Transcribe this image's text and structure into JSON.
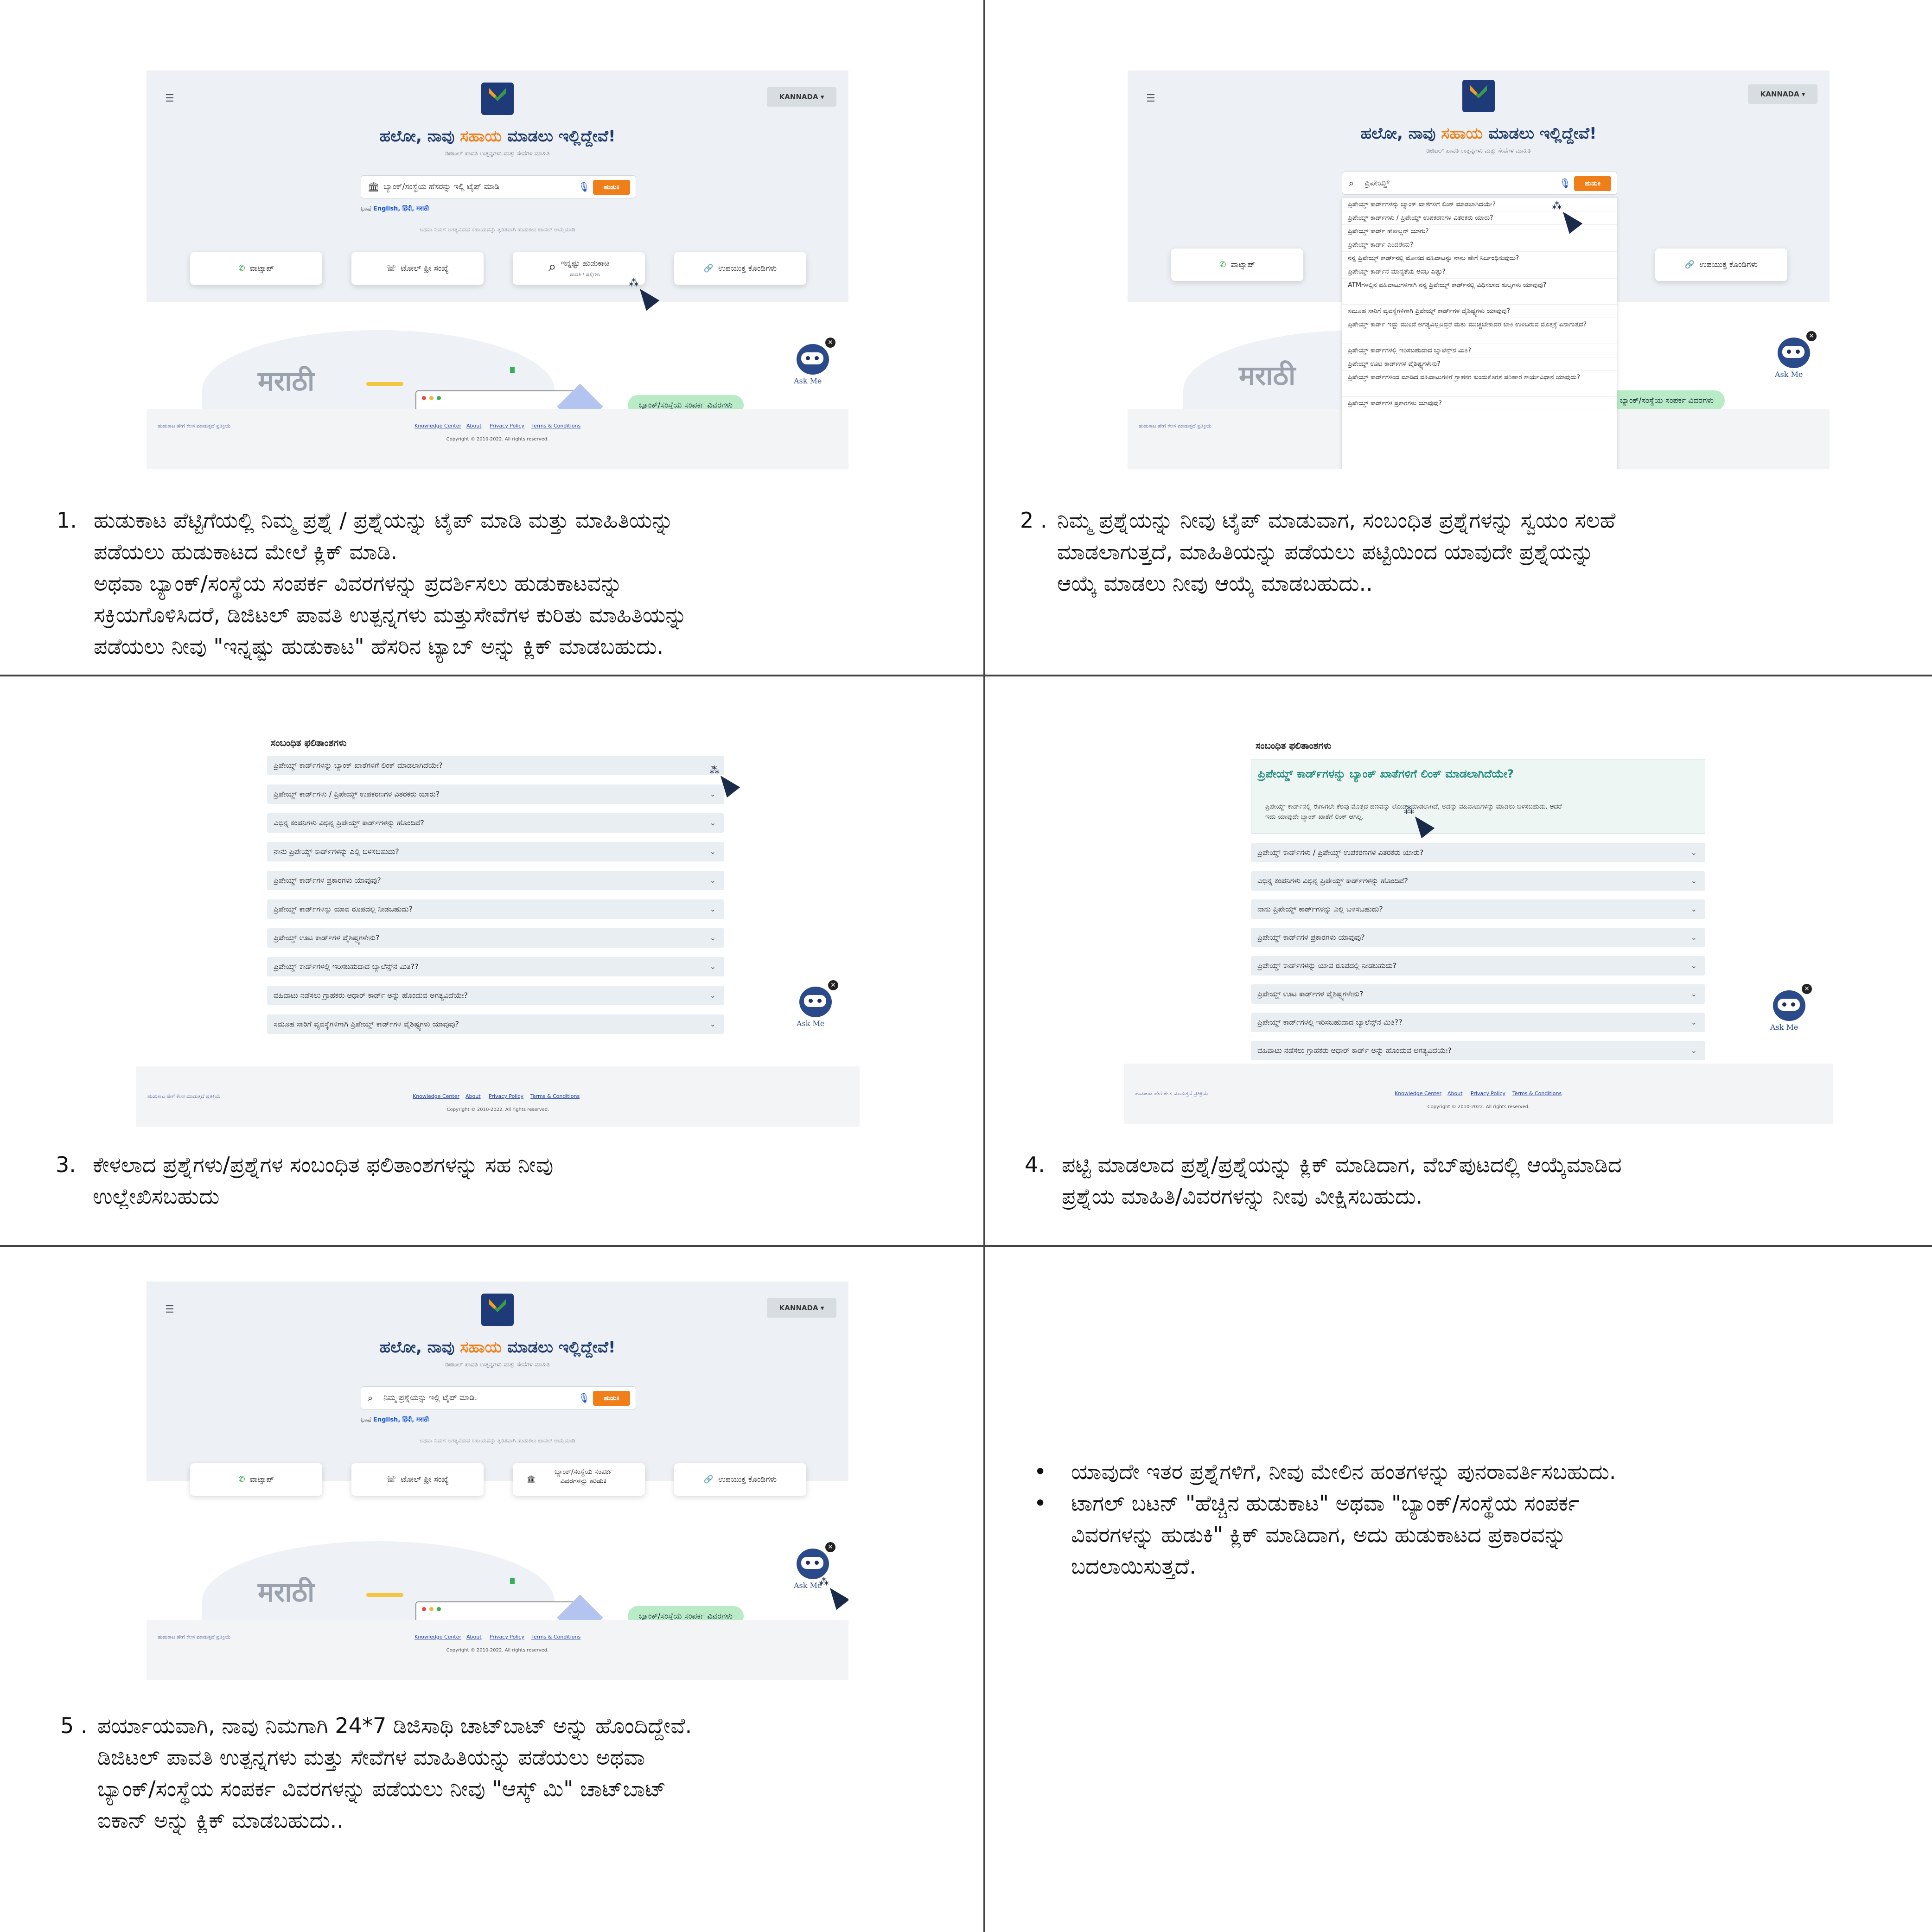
{
  "panels": {
    "p1": {
      "num": "1.",
      "lines": [
        "ಹುಡುಕಾಟ ಪೆಟ್ಟಿಗೆಯಲ್ಲಿ ನಿಮ್ಮ ಪ್ರಶ್ನೆ / ಪ್ರಶ್ನೆಯನ್ನು ಟೈಪ್ ಮಾಡಿ ಮತ್ತು ಮಾಹಿತಿಯನ್ನು",
        "ಪಡೆಯಲು ಹುಡುಕಾಟದ ಮೇಲೆ ಕ್ಲಿಕ್ ಮಾಡಿ.",
        "ಅಥವಾ ಬ್ಯಾಂಕ್/ಸಂಸ್ಥೆಯ ಸಂಪರ್ಕ ವಿವರಗಳನ್ನು ಪ್ರದರ್ಶಿಸಲು ಹುಡುಕಾಟವನ್ನು",
        "ಸಕ್ರಿಯಗೊಳಿಸಿದರೆ, ಡಿಜಿಟಲ್ ಪಾವತಿ ಉತ್ಪನ್ನಗಳು ಮತ್ತುಸೇವೆಗಳ ಕುರಿತು ಮಾಹಿತಿಯನ್ನು",
        "ಪಡೆಯಲು ನೀವು \"ಇನ್ನಷ್ಟು ಹುಡುಕಾಟ\" ಹೆಸರಿನ ಟ್ಯಾಬ್ ಅನ್ನು ಕ್ಲಿಕ್ ಮಾಡಬಹುದು."
      ]
    },
    "p2": {
      "num": "2 .",
      "lines": [
        "ನಿಮ್ಮ ಪ್ರಶ್ನೆಯನ್ನು ನೀವು ಟೈಪ್ ಮಾಡುವಾಗ, ಸಂಬಂಧಿತ ಪ್ರಶ್ನೆಗಳನ್ನು ಸ್ವಯಂ ಸಲಹೆ",
        "ಮಾಡಲಾಗುತ್ತದೆ, ಮಾಹಿತಿಯನ್ನು ಪಡೆಯಲು ಪಟ್ಟಿಯಿಂದ ಯಾವುದೇ ಪ್ರಶ್ನೆಯನ್ನು",
        "ಆಯ್ಕೆ ಮಾಡಲು ನೀವು ಆಯ್ಕೆ ಮಾಡಬಹುದು.."
      ]
    },
    "p3": {
      "num": "3.",
      "lines": [
        "ಕೇಳಲಾದ ಪ್ರಶ್ನೆಗಳು/ಪ್ರಶ್ನೆಗಳ ಸಂಬಂಧಿತ ಫಲಿತಾಂಶಗಳನ್ನು ಸಹ ನೀವು",
        "ಉಲ್ಲೇಖಿಸಬಹುದು"
      ]
    },
    "p4": {
      "num": "4.",
      "lines": [
        "ಪಟ್ಟಿ ಮಾಡಲಾದ ಪ್ರಶ್ನೆ/ಪ್ರಶ್ನೆಯನ್ನು ಕ್ಲಿಕ್ ಮಾಡಿದಾಗ, ವೆಬ್‌ಪುಟದಲ್ಲಿ ಆಯ್ಕೆಮಾಡಿದ",
        "ಪ್ರಶ್ನೆಯ ಮಾಹಿತಿ/ವಿವರಗಳನ್ನು ನೀವು ವೀಕ್ಷಿಸಬಹುದು."
      ]
    },
    "p5": {
      "num": "5 .",
      "lines": [
        "ಪರ್ಯಾಯವಾಗಿ, ನಾವು ನಿಮಗಾಗಿ 24*7 ಡಿಜಿಸಾಥಿ ಚಾಟ್‌ಬಾಟ್ ಅನ್ನು   ಹೊಂದಿದ್ದೇವೆ.",
        "ಡಿಜಿಟಲ್ ಪಾವತಿ ಉತ್ಪನ್ನಗಳು ಮತ್ತು   ಸೇವೆಗಳ ಮಾಹಿತಿಯನ್ನು   ಪಡೆಯಲು ಅಥವಾ",
        "ಬ್ಯಾಂಕ್/ಸಂಸ್ಥೆಯ ಸಂಪರ್ಕ ವಿವರಗಳನ್ನು ಪಡೆಯಲು ನೀವು \"ಆಸ್ಕ್ ಮಿ\" ಚಾಟ್‌ಬಾಟ್",
        "ಐಕಾನ್ ಅನ್ನು   ಕ್ಲಿಕ್ ಮಾಡಬಹುದು.."
      ]
    },
    "p6": {
      "bullets": [
        [
          "ಯಾವುದೇ ಇತರ ಪ್ರಶ್ನೆಗಳಿಗೆ, ನೀವು ಮೇಲಿನ ಹಂತಗಳನ್ನು   ಪುನರಾವರ್ತಿಸಬಹುದು."
        ],
        [
          "ಟಾಗಲ್ ಬಟನ್ \"ಹೆಚ್ಚಿನ ಹುಡುಕಾಟ\" ಅಥವಾ \"ಬ್ಯಾಂಕ್/ಸಂಸ್ಥೆಯ ಸಂಪರ್ಕ",
          "ವಿವರಗಳನ್ನು ಹುಡುಕಿ\" ಕ್ಲಿಕ್ ಮಾಡಿದಾಗ, ಅದು ಹುಡುಕಾಟದ ಪ್ರಕಾರವನ್ನು",
          "ಬದಲಾಯಿಸುತ್ತದೆ."
        ]
      ]
    }
  },
  "ui": {
    "logo_text": "DigiSaathi",
    "lang_button": "KANNADA ▾",
    "hero_title_a": "ಹಲೋ, ನಾವು ",
    "hero_title_b": "ಸಹಾಯ",
    "hero_title_c": " ಮಾಡಲು ಇಲ್ಲಿದ್ದೇವೆ!",
    "hero_sub": "ಡಿಜಿಟಲ್ ಪಾವತಿ ಉತ್ಪನ್ನಗಳು ಮತ್ತು ಸೇವೆಗಳ ಮಾಹಿತಿ",
    "search_placeholder_bank": "ಬ್ಯಾಂಕ್/ಸಂಸ್ಥೆಯ ಹೆಸರನ್ನು ಇಲ್ಲಿ ಟೈಪ್ ಮಾಡಿ",
    "search_placeholder_q": "ನಿಮ್ಮ ಪ್ರಶ್ನೆಯನ್ನು ಇಲ್ಲಿ ಟೈಪ್ ಮಾಡಿ.",
    "search_typed": "ಪ್ರಿಪೇಯ್ಡ್",
    "search_btn": "ಹುಡುಕಿ",
    "langs_prefix": "ಭಾಷೆ",
    "langs": "English, हिंदी, मराठी",
    "hint": "ಅಥವಾ ನಿಮಗೆ ಅಗತ್ಯವಿರುವ ಸಹಾಯವನ್ನು ತ್ವರಿತವಾಗಿ ಹುಡುಕಲು ಚಾನಲ್ ಆಯ್ಕೆಮಾಡಿ",
    "card_whatsapp": "ವಾಟ್ಸಾಪ್",
    "card_tollfree": "ಟೋಲ್ ಫ್ರೀ ಸಂಖ್ಯೆ",
    "card_more": "ಇನ್ನಷ್ಟು ಹುಡುಕಾಟ",
    "card_more_sub": "ಪಾವತಿ / ಪ್ರಶ್ನೆಗಳು",
    "card_bank": "ಬ್ಯಾಂಕ್/ಸಂಸ್ಥೆಯ ಸಂಪರ್ಕ ವಿವರಗಳನ್ನು ಹುಡುಕಿ",
    "card_links": "ಉಪಯುಕ್ತ ಕೊಂಡಿಗಳು",
    "marathi": "मराठी",
    "pill": "ಬ್ಯಾಂಕ್/ಸಂಸ್ಥೆಯ ಸಂಪರ್ಕ ವಿವರಗಳು",
    "footer_left": "ಹುಡುಕಾಟ ಹೇಗೆ ಕೆಲಸ ಮಾಡುತ್ತದೆ   ಪ್ರತಿಕ್ರಿಯೆ",
    "footer_links": [
      "Knowledge Center",
      "About",
      "Privacy Policy",
      "Terms & Conditions"
    ],
    "copyright": "Copyright © 2010-2022. All rights reserved.",
    "askme": "Ask Me",
    "related_title": "ಸಂಬಂಧಿತ ಫಲಿತಾಂಶಗಳು",
    "open_q": "ಪ್ರಿಪೇಯ್ಡ್ ಕಾರ್ಡ್‌ಗಳನ್ನು ಬ್ಯಾಂಕ್ ಖಾತೆಗಳಿಗೆ ಲಿಂಕ್ ಮಾಡಲಾಗಿದೆಯೇ?",
    "open_a1": "ಪ್ರಿಪೇಯ್ಡ್ ಕಾರ್ಡ್‌ನಲ್ಲಿ ಈಗಾಗಲೇ ಕೆಲವು ಮೊತ್ತದ ಹಣವನ್ನು ಲೋಡ್ ಮಾಡಲಾಗಿದೆ, ಅದನ್ನು ವಹಿವಾಟುಗಳನ್ನು ಮಾಡಲು ಬಳಸಬಹುದು. ಆದರೆ",
    "open_a2": "ಇದು ಯಾವುದೇ ಬ್ಯಾಂಕ್ ಖಾತೆಗೆ ಲಿಂಕ್ ಆಗಿಲ್ಲ.",
    "suggestions": [
      "ಪ್ರಿಪೇಯ್ಡ್ ಕಾರ್ಡ್‌ಗಳನ್ನು ಬ್ಯಾಂಕ್ ಖಾತೆಗಳಿಗೆ ಲಿಂಕ್ ಮಾಡಲಾಗಿದೆಯೇ?",
      "ಪ್ರಿಪೇಯ್ಡ್ ಕಾರ್ಡ್‌ಗಳು / ಪ್ರಿಪೇಯ್ಡ್ ಉಪಕರಣಗಳ ವಿತರಕರು ಯಾರು?",
      "ಪ್ರಿಪೇಯ್ಡ್ ಕಾರ್ಡ್ ಹೋಲ್ಡರ್ ಯಾರು?",
      "ಪ್ರಿಪೇಯ್ಡ್ ಕಾರ್ಡ್ ಎಂದರೇನು?",
      "ನನ್ನ ಪ್ರಿಪೇಯ್ಡ್ ಕಾರ್ಡ್‌ನಲ್ಲಿ ಮೋಸದ ವಹಿವಾಟನ್ನು ನಾನು ಹೇಗೆ ನಿರ್ಬಂಧಿಸುವುದು?",
      "ಪ್ರಿಪೇಯ್ಡ್ ಕಾರ್ಡ್‌ನ ಮಾನ್ಯತೆಯ ಅವಧಿ ಎಷ್ಟು?",
      "ATMಗಳಲ್ಲಿನ ವಹಿವಾಟುಗಳಿಗಾಗಿ ನನ್ನ ಪ್ರಿಪೇಯ್ಡ್ ಕಾರ್ಡ್‌ನಲ್ಲಿ ವಿಧಿಸಲಾದ ಶುಲ್ಕಗಳು ಯಾವುವು?",
      "ಸಮೂಹ ಸಾರಿಗೆ ವ್ಯವಸ್ಥೆಗಳಿಗಾಗಿ ಪ್ರಿಪೇಯ್ಡ್ ಕಾರ್ಡ್‌ಗಳ ವೈಶಿಷ್ಟ್ಯಗಳು ಯಾವುವು?",
      "ಪ್ರಿಪೇಯ್ಡ್ ಕಾರ್ಡ್ ಇದ್ದು ಮುಂದೆ ಅಗತ್ಯವಿಲ್ಲದಿದ್ದರೆ ಮತ್ತು ಮುಚ್ಚಬೇಕಾದರೆ ಬಾಕಿ ಉಳಿದಿರುವ ಮೊತ್ತಕ್ಕೆ ಏನಾಗುತ್ತದೆ?",
      "ಪ್ರಿಪೇಯ್ಡ್ ಕಾರ್ಡ್‌ಗಳಲ್ಲಿ ಇರಿಸಬಹುದಾದ ಬ್ಯಾಲೆನ್ಸ್‌ನ ಮಿತಿ?",
      "ಪ್ರಿಪೇಯ್ಡ್ ಊಟ ಕಾರ್ಡ್‌ಗಳ ವೈಶಿಷ್ಟ್ಯಗಳೇನು?",
      "ಪ್ರಿಪೇಯ್ಡ್ ಕಾರ್ಡ್‌ಗಳಿಂದ ಮಾಡಿದ ವಹಿವಾಟುಗಳಿಗೆ ಗ್ರಾಹಕರ ಕುಂದುಕೊರತೆ ಪರಿಹಾರ ಕಾರ್ಯವಿಧಾನ ಯಾವುದು?",
      "ಪ್ರಿಪೇಯ್ಡ್ ಕಾರ್ಡ್‌ಗಳ ಪ್ರಕಾರಗಳು ಯಾವುವು?"
    ],
    "related3": [
      "ಪ್ರಿಪೇಯ್ಡ್ ಕಾರ್ಡ್‌ಗಳನ್ನು ಬ್ಯಾಂಕ್ ಖಾತೆಗಳಿಗೆ ಲಿಂಕ್ ಮಾಡಲಾಗಿದೆಯೇ?",
      "ಪ್ರಿಪೇಯ್ಡ್ ಕಾರ್ಡ್‌ಗಳು / ಪ್ರಿಪೇಯ್ಡ್ ಉಪಕರಣಗಳ ವಿತರಕರು ಯಾರು?",
      "ವಿಭಿನ್ನ ಕಂಪನಿಗಳು ವಿಭಿನ್ನ ಪ್ರಿಪೇಯ್ಡ್ ಕಾರ್ಡ್‌ಗಳನ್ನು ಹೊಂದಿವೆ?",
      "ನಾನು ಪ್ರಿಪೇಯ್ಡ್ ಕಾರ್ಡ್‌ಗಳನ್ನು ಎಲ್ಲಿ ಬಳಸಬಹುದು?",
      "ಪ್ರಿಪೇಯ್ಡ್ ಕಾರ್ಡ್‌ಗಳ ಪ್ರಕಾರಗಳು ಯಾವುವು?",
      "ಪ್ರಿಪೇಯ್ಡ್ ಕಾರ್ಡ್‌ಗಳನ್ನು ಯಾವ ರೂಪದಲ್ಲಿ ನೀಡಬಹುದು?",
      "ಪ್ರಿಪೇಯ್ಡ್ ಊಟ ಕಾರ್ಡ್‌ಗಳ ವೈಶಿಷ್ಟ್ಯಗಳೇನು?",
      "ಪ್ರಿಪೇಯ್ಡ್ ಕಾರ್ಡ್‌ಗಳಲ್ಲಿ ಇರಿಸಬಹುದಾದ ಬ್ಯಾಲೆನ್ಸ್‌ನ ಮಿತಿ??",
      "ವಹಿವಾಟು ನಡೆಸಲು ಗ್ರಾಹಕರು ಆಧಾರ್ ಕಾರ್ಡ್ ಅನ್ನು ಹೊಂದುವ ಅಗತ್ಯವಿದೆಯೇ?",
      "ಸಮೂಹ ಸಾರಿಗೆ ವ್ಯವಸ್ಥೆಗಳಿಗಾಗಿ ಪ್ರಿಪೇಯ್ಡ್ ಕಾರ್ಡ್‌ಗಳ ವೈಶಿಷ್ಟ್ಯಗಳು ಯಾವುವು?"
    ],
    "related4": [
      "ಪ್ರಿಪೇಯ್ಡ್ ಕಾರ್ಡ್‌ಗಳು / ಪ್ರಿಪೇಯ್ಡ್ ಉಪಕರಣಗಳ ವಿತರಕರು ಯಾರು?",
      "ವಿಭಿನ್ನ ಕಂಪನಿಗಳು ವಿಭಿನ್ನ ಪ್ರಿಪೇಯ್ಡ್ ಕಾರ್ಡ್‌ಗಳನ್ನು ಹೊಂದಿವೆ?",
      "ನಾನು ಪ್ರಿಪೇಯ್ಡ್ ಕಾರ್ಡ್‌ಗಳನ್ನು ಎಲ್ಲಿ ಬಳಸಬಹುದು?",
      "ಪ್ರಿಪೇಯ್ಡ್ ಕಾರ್ಡ್‌ಗಳ ಪ್ರಕಾರಗಳು ಯಾವುವು?",
      "ಪ್ರಿಪೇಯ್ಡ್ ಕಾರ್ಡ್‌ಗಳನ್ನು ಯಾವ ರೂಪದಲ್ಲಿ ನೀಡಬಹುದು?",
      "ಪ್ರಿಪೇಯ್ಡ್ ಊಟ ಕಾರ್ಡ್‌ಗಳ ವೈಶಿಷ್ಟ್ಯಗಳೇನು?",
      "ಪ್ರಿಪೇಯ್ಡ್ ಕಾರ್ಡ್‌ಗಳಲ್ಲಿ ಇರಿಸಬಹುದಾದ ಬ್ಯಾಲೆನ್ಸ್‌ನ ಮಿತಿ??",
      "ವಹಿವಾಟು ನಡೆಸಲು ಗ್ರಾಹಕರು ಆಧಾರ್ ಕಾರ್ಡ್ ಅನ್ನು ಹೊಂದುವ ಅಗತ್ಯವಿದೆಯೇ?"
    ]
  },
  "colors": {
    "accent": "#f07f1a",
    "navy": "#1e3a6a",
    "teal": "#1f8a7a",
    "pill": "#b8ebc6"
  }
}
